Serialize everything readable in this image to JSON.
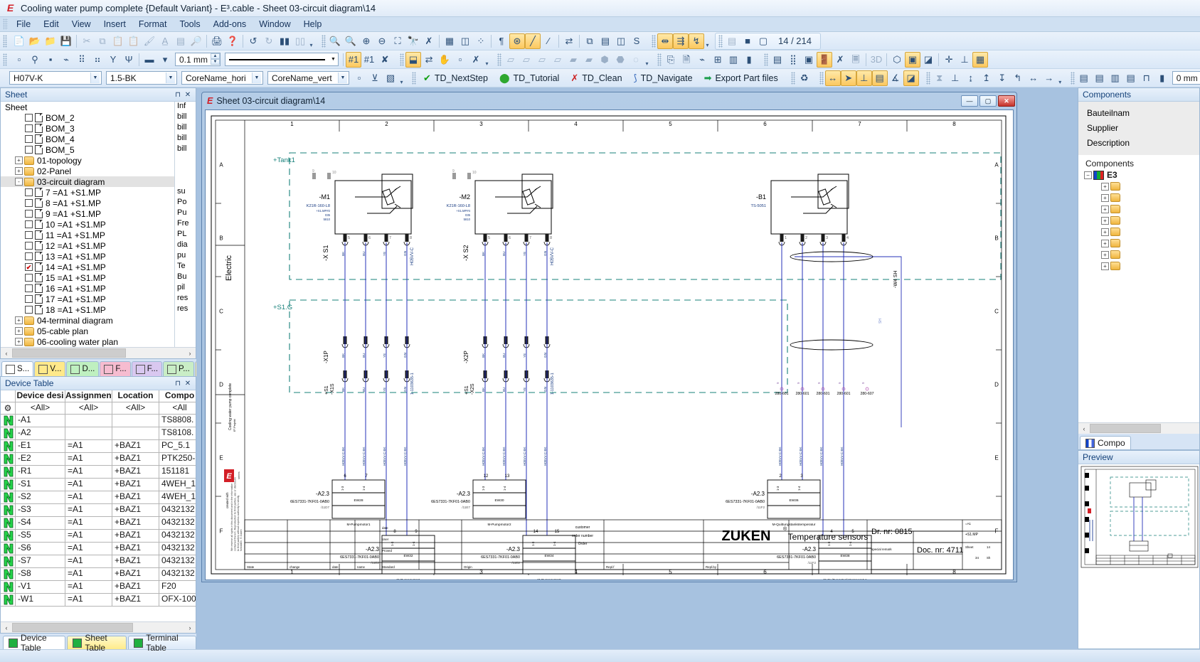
{
  "window": {
    "title": "Cooling water pump complete {Default Variant} - E³.cable - Sheet 03-circuit diagram\\14",
    "app_icon": "e3-logo-icon"
  },
  "menu": {
    "items": [
      "File",
      "Edit",
      "View",
      "Insert",
      "Format",
      "Tools",
      "Add-ons",
      "Window",
      "Help"
    ]
  },
  "toolbar": {
    "page_counter": "14 / 214",
    "line_width_value": "0.1 mm",
    "zero_mm_value": "0 mm",
    "cable_type": "H07V-K",
    "core_spec": "1.5-BK",
    "corename_hori": "CoreName_hori",
    "corename_vert": "CoreName_vert",
    "threed_label": "3D",
    "macros": [
      {
        "label": "TD_NextStep",
        "icon": "green-check-icon"
      },
      {
        "label": "TD_Tutorial",
        "icon": "green-balloon-icon"
      },
      {
        "label": "TD_Clean",
        "icon": "red-broom-icon"
      },
      {
        "label": "TD_Navigate",
        "icon": "blue-arc-icon"
      },
      {
        "label": "Export Part files",
        "icon": "green-arrow-icon"
      }
    ]
  },
  "sheet_panel": {
    "title": "Sheet",
    "root": "Sheet",
    "info_header": "Inf",
    "items": [
      {
        "label": "BOM_2",
        "type": "doc",
        "checked": false,
        "depth": 2,
        "info": "bill"
      },
      {
        "label": "BOM_3",
        "type": "doc",
        "checked": false,
        "depth": 2,
        "info": "bill"
      },
      {
        "label": "BOM_4",
        "type": "doc",
        "checked": false,
        "depth": 2,
        "info": "bill"
      },
      {
        "label": "BOM_5",
        "type": "doc",
        "checked": false,
        "depth": 2,
        "info": "bill"
      },
      {
        "label": "01-topology",
        "type": "folder",
        "expander": "+",
        "depth": 1,
        "info": ""
      },
      {
        "label": "02-Panel",
        "type": "folder",
        "expander": "+",
        "depth": 1,
        "info": ""
      },
      {
        "label": "03-circuit diagram",
        "type": "folder",
        "expander": "-",
        "depth": 1,
        "info": "",
        "selected": true
      },
      {
        "label": "7 =A1 +S1.MP",
        "type": "doc",
        "checked": false,
        "depth": 2,
        "info": "su"
      },
      {
        "label": "8 =A1 +S1.MP",
        "type": "doc",
        "checked": false,
        "depth": 2,
        "info": "Po"
      },
      {
        "label": "9 =A1 +S1.MP",
        "type": "doc",
        "checked": false,
        "depth": 2,
        "info": "Pu"
      },
      {
        "label": "10 =A1 +S1.MP",
        "type": "doc",
        "checked": false,
        "depth": 2,
        "info": "Fre"
      },
      {
        "label": "11 =A1 +S1.MP",
        "type": "doc",
        "checked": false,
        "depth": 2,
        "info": "PL"
      },
      {
        "label": "12 =A1 +S1.MP",
        "type": "doc",
        "checked": false,
        "depth": 2,
        "info": "dia"
      },
      {
        "label": "13 =A1 +S1.MP",
        "type": "doc",
        "checked": false,
        "depth": 2,
        "info": "pu"
      },
      {
        "label": "14 =A1 +S1.MP",
        "type": "doc",
        "checked": true,
        "depth": 2,
        "info": "Te"
      },
      {
        "label": "15 =A1 +S1.MP",
        "type": "doc",
        "checked": false,
        "depth": 2,
        "info": "Bu"
      },
      {
        "label": "16 =A1 +S1.MP",
        "type": "doc",
        "checked": false,
        "depth": 2,
        "info": "pil"
      },
      {
        "label": "17 =A1 +S1.MP",
        "type": "doc",
        "checked": false,
        "depth": 2,
        "info": "res"
      },
      {
        "label": "18 =A1 +S1.MP",
        "type": "doc",
        "checked": false,
        "depth": 2,
        "info": "res"
      },
      {
        "label": "04-terminal diagram",
        "type": "folder",
        "expander": "+",
        "depth": 1,
        "info": ""
      },
      {
        "label": "05-cable plan",
        "type": "folder",
        "expander": "+",
        "depth": 1,
        "info": ""
      },
      {
        "label": "06-cooling water plan",
        "type": "folder",
        "expander": "+",
        "depth": 1,
        "info": ""
      }
    ],
    "tabs": [
      {
        "label": "S...",
        "color": "#ffffff"
      },
      {
        "label": "V...",
        "color": "#ffe98a"
      },
      {
        "label": "D...",
        "color": "#bff0c0"
      },
      {
        "label": "F...",
        "color": "#f6bcd0"
      },
      {
        "label": "F...",
        "color": "#d9c8f0"
      },
      {
        "label": "P...",
        "color": "#c9edc6"
      },
      {
        "label": "P...",
        "color": "#ffeaa0"
      }
    ]
  },
  "device_table": {
    "title": "Device Table",
    "columns": [
      "Device desi",
      "Assignment",
      "Location",
      "Compo"
    ],
    "filter_row": [
      "<All>",
      "<All>",
      "<All>",
      "<All"
    ],
    "rows": [
      {
        "device": "-A1",
        "assignment": "",
        "location": "",
        "component": "TS8808."
      },
      {
        "device": "-A2",
        "assignment": "",
        "location": "",
        "component": "TS8108."
      },
      {
        "device": "-E1",
        "assignment": "=A1",
        "location": "+BAZ1",
        "component": "PC_5.1"
      },
      {
        "device": "-E2",
        "assignment": "=A1",
        "location": "+BAZ1",
        "component": "PTK250-"
      },
      {
        "device": "-R1",
        "assignment": "=A1",
        "location": "+BAZ1",
        "component": "151181"
      },
      {
        "device": "-S1",
        "assignment": "=A1",
        "location": "+BAZ1",
        "component": "4WEH_1"
      },
      {
        "device": "-S2",
        "assignment": "=A1",
        "location": "+BAZ1",
        "component": "4WEH_1"
      },
      {
        "device": "-S3",
        "assignment": "=A1",
        "location": "+BAZ1",
        "component": "0432132"
      },
      {
        "device": "-S4",
        "assignment": "=A1",
        "location": "+BAZ1",
        "component": "0432132"
      },
      {
        "device": "-S5",
        "assignment": "=A1",
        "location": "+BAZ1",
        "component": "0432132"
      },
      {
        "device": "-S6",
        "assignment": "=A1",
        "location": "+BAZ1",
        "component": "0432132"
      },
      {
        "device": "-S7",
        "assignment": "=A1",
        "location": "+BAZ1",
        "component": "0432132"
      },
      {
        "device": "-S8",
        "assignment": "=A1",
        "location": "+BAZ1",
        "component": "0432132"
      },
      {
        "device": "-V1",
        "assignment": "=A1",
        "location": "+BAZ1",
        "component": "F20"
      },
      {
        "device": "-W1",
        "assignment": "=A1",
        "location": "+BAZ1",
        "component": "OFX-100"
      }
    ],
    "bottom_tabs": [
      {
        "label": "Device Table",
        "active": true
      },
      {
        "label": "Sheet Table",
        "active": false,
        "highlight": true
      },
      {
        "label": "Terminal Table",
        "active": false
      }
    ]
  },
  "components_panel": {
    "title": "Components",
    "properties": [
      "Bauteilnam",
      "Supplier",
      "Description"
    ],
    "tree_label": "Components",
    "root": "E3",
    "folder_count": 8,
    "tab_label": "Compo"
  },
  "preview_panel": {
    "title": "Preview"
  },
  "drawing": {
    "mdi_title": "Sheet 03-circuit diagram\\14",
    "col_labels": [
      "1",
      "2",
      "3",
      "4",
      "5",
      "6",
      "7",
      "8"
    ],
    "row_labels": [
      "A",
      "B",
      "C",
      "D",
      "E",
      "F"
    ],
    "side_label": "Electric",
    "side_sub": "Cooling water pump complete",
    "side_note": "We reserve all rights in this document and in the information contained therein. Reproduction to third parties without express authority is strictly forbidden. © Zuken",
    "logo_text": "E3 series",
    "locations": [
      {
        "name": "+Tank1"
      },
      {
        "name": "+S1.G"
      }
    ],
    "sensors": [
      {
        "tag": "-M1",
        "part": "K21R-160-L8",
        "sub1": "+S1.MP#2",
        "sub2": "035",
        "sub3": "5810",
        "terminal": "-X S1",
        "pins": [
          "5",
          "6",
          "7",
          "8"
        ],
        "cable": "H05VV-C"
      },
      {
        "tag": "-M2",
        "part": "K21R-160-L8",
        "sub1": "+S1.MP#4",
        "sub2": "035",
        "sub3": "5810",
        "terminal": "-X S2",
        "pins": [
          "5",
          "6",
          "7",
          "8"
        ],
        "cable": "H05VV-C"
      },
      {
        "tag": "-B1",
        "part": "TS-5051",
        "sub1": "",
        "sub2": "",
        "sub3": "",
        "terminal": "",
        "pins": [
          "1",
          "2",
          "3",
          "4"
        ],
        "cable": "-W4 SH"
      }
    ],
    "plugs": [
      {
        "name": "-X1P",
        "pair": "-X1S",
        "prefix": "+S1",
        "cable": "1-1103635-1"
      },
      {
        "name": "-X2P",
        "pair": "-X2S",
        "prefix": "+S1",
        "cable": "1-1103635-1"
      }
    ],
    "plcs": [
      {
        "tag": "-A2.3",
        "part": "6ES7331-7KF01-0AB0",
        "ref": "/11D7",
        "ch": "EW28",
        "pins": [
          "6",
          "7"
        ],
        "caption": "M-Pumpmotor1"
      },
      {
        "tag": "-A2.3",
        "part": "6ES7331-7KF01-0AB0",
        "ref": "/11E7",
        "ch": "EW30",
        "pins": [
          "12",
          "13"
        ],
        "caption": "M-Pumpmotor2"
      },
      {
        "tag": "-A2.3",
        "part": "6ES7331-7KF01-0AB0",
        "ref": "/11E2",
        "ch": "EW32",
        "pins": [
          "8",
          "9"
        ],
        "caption": "M-Pumpmotor1"
      },
      {
        "tag": "-A2.3",
        "part": "6ES7331-7KF01-0AB0",
        "ref": "/11E2",
        "ch": "EW34",
        "pins": [
          "14",
          "15"
        ],
        "caption": "M-Pumpmotor2"
      },
      {
        "tag": "-A2.3",
        "part": "6ES7331-7KF01-0AB0",
        "ref": "/11F2",
        "ch": "EW36",
        "pins": [
          "2",
          "3"
        ],
        "caption": "M-Quittungstankstemperatur"
      },
      {
        "tag": "-A2.3",
        "part": "6ES7331-7KF01-0AB0",
        "ref": "/11F2",
        "ch": "EW38",
        "pins": [
          "4",
          "5"
        ],
        "caption": "M-Quittungstankstemperatur"
      }
    ],
    "wire_tags": [
      "280-601",
      "280-601",
      "280-601",
      "280-601",
      "280-607"
    ],
    "title_block": {
      "title": "Temperature sensors",
      "drawing_no": "Dr. nr: 0815",
      "doc_no": "Doc. nr: 4711",
      "special_remark": "special remark",
      "assignment": "=A1",
      "location": "+S1.MP",
      "brand": "ZUKEN",
      "customer": "customer",
      "order_number": "order number",
      "order": "Order",
      "sheet_label": "Sheet",
      "sheet_value": "14",
      "sheets_total": "34",
      "sheets_unit": "Sh",
      "cols": [
        "State",
        "change",
        "date",
        "name",
        "Standard",
        "Origin",
        "Repl.f",
        "Repl.by"
      ],
      "sub_rows": [
        "date",
        "User",
        "Proved"
      ]
    }
  }
}
